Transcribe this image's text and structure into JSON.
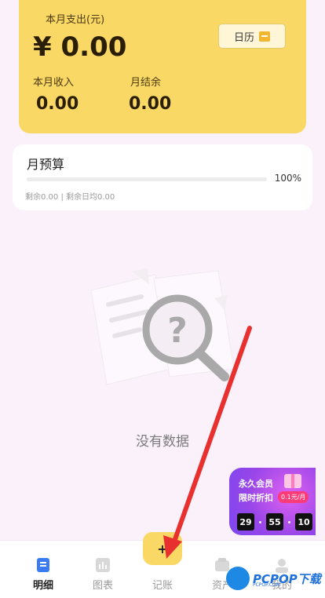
{
  "summary": {
    "expense_label": "本月支出(元)",
    "expense_value": "¥ 0.00",
    "calendar_label": "日历",
    "income_label": "本月收入",
    "income_value": "0.00",
    "balance_label": "月结余",
    "balance_value": "0.00"
  },
  "budget": {
    "title": "月预算",
    "percent_text": "100%",
    "percent_fill": 1.0,
    "remaining_text": "剩余0.00 | 剩余日均0.00"
  },
  "empty_state": {
    "message": "没有数据"
  },
  "promo": {
    "line1": "永久会员",
    "line2": "限时折扣",
    "price": "0.1元/月",
    "countdown": [
      "29",
      "55",
      "10"
    ]
  },
  "tabs": [
    {
      "label": "明细",
      "icon": "list-detail-icon",
      "active": true
    },
    {
      "label": "图表",
      "icon": "bar-chart-icon",
      "active": false
    },
    {
      "label": "记账",
      "icon": "add-record-icon",
      "active": false
    },
    {
      "label": "资产",
      "icon": "wallet-icon",
      "active": false
    },
    {
      "label": "我的",
      "icon": "user-icon",
      "active": false
    }
  ],
  "add_button_glyph": "+",
  "watermark": {
    "text": "PCPOP下载",
    "sub": "PCPOP.COM"
  },
  "colors": {
    "accent": "#fad866",
    "background": "#faf1fb",
    "annotation": "#e8302e"
  }
}
